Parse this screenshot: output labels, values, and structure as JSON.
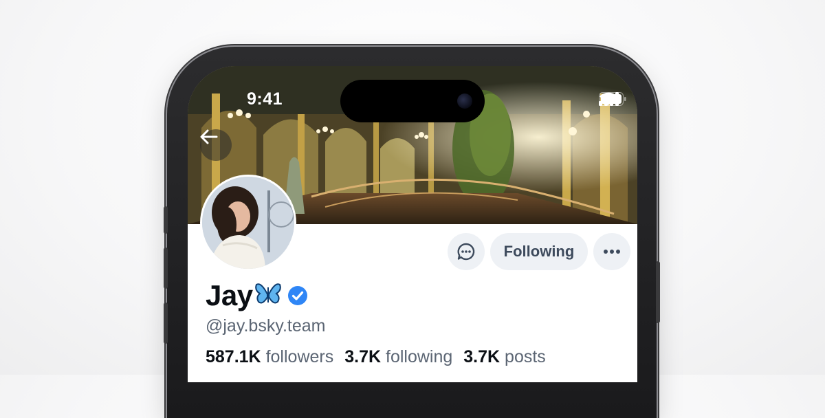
{
  "status_bar": {
    "time": "9:41"
  },
  "profile": {
    "display_name": "Jay",
    "handle": "@jay.bsky.team",
    "verified": true,
    "stats": [
      {
        "value": "587.1K",
        "label": "followers"
      },
      {
        "value": "3.7K",
        "label": "following"
      },
      {
        "value": "3.7K",
        "label": "posts"
      }
    ]
  },
  "actions": {
    "following_label": "Following"
  },
  "icons": {
    "back": "back-arrow-icon",
    "message": "chat-bubble-icon",
    "more": "more-horizontal-icon",
    "verified": "verified-check-icon",
    "butterfly": "butterfly-emoji"
  },
  "colors": {
    "verified_blue": "#2f86f6",
    "button_bg": "#eef1f5",
    "text_primary": "#0b0f14",
    "text_secondary": "#5b6573"
  }
}
